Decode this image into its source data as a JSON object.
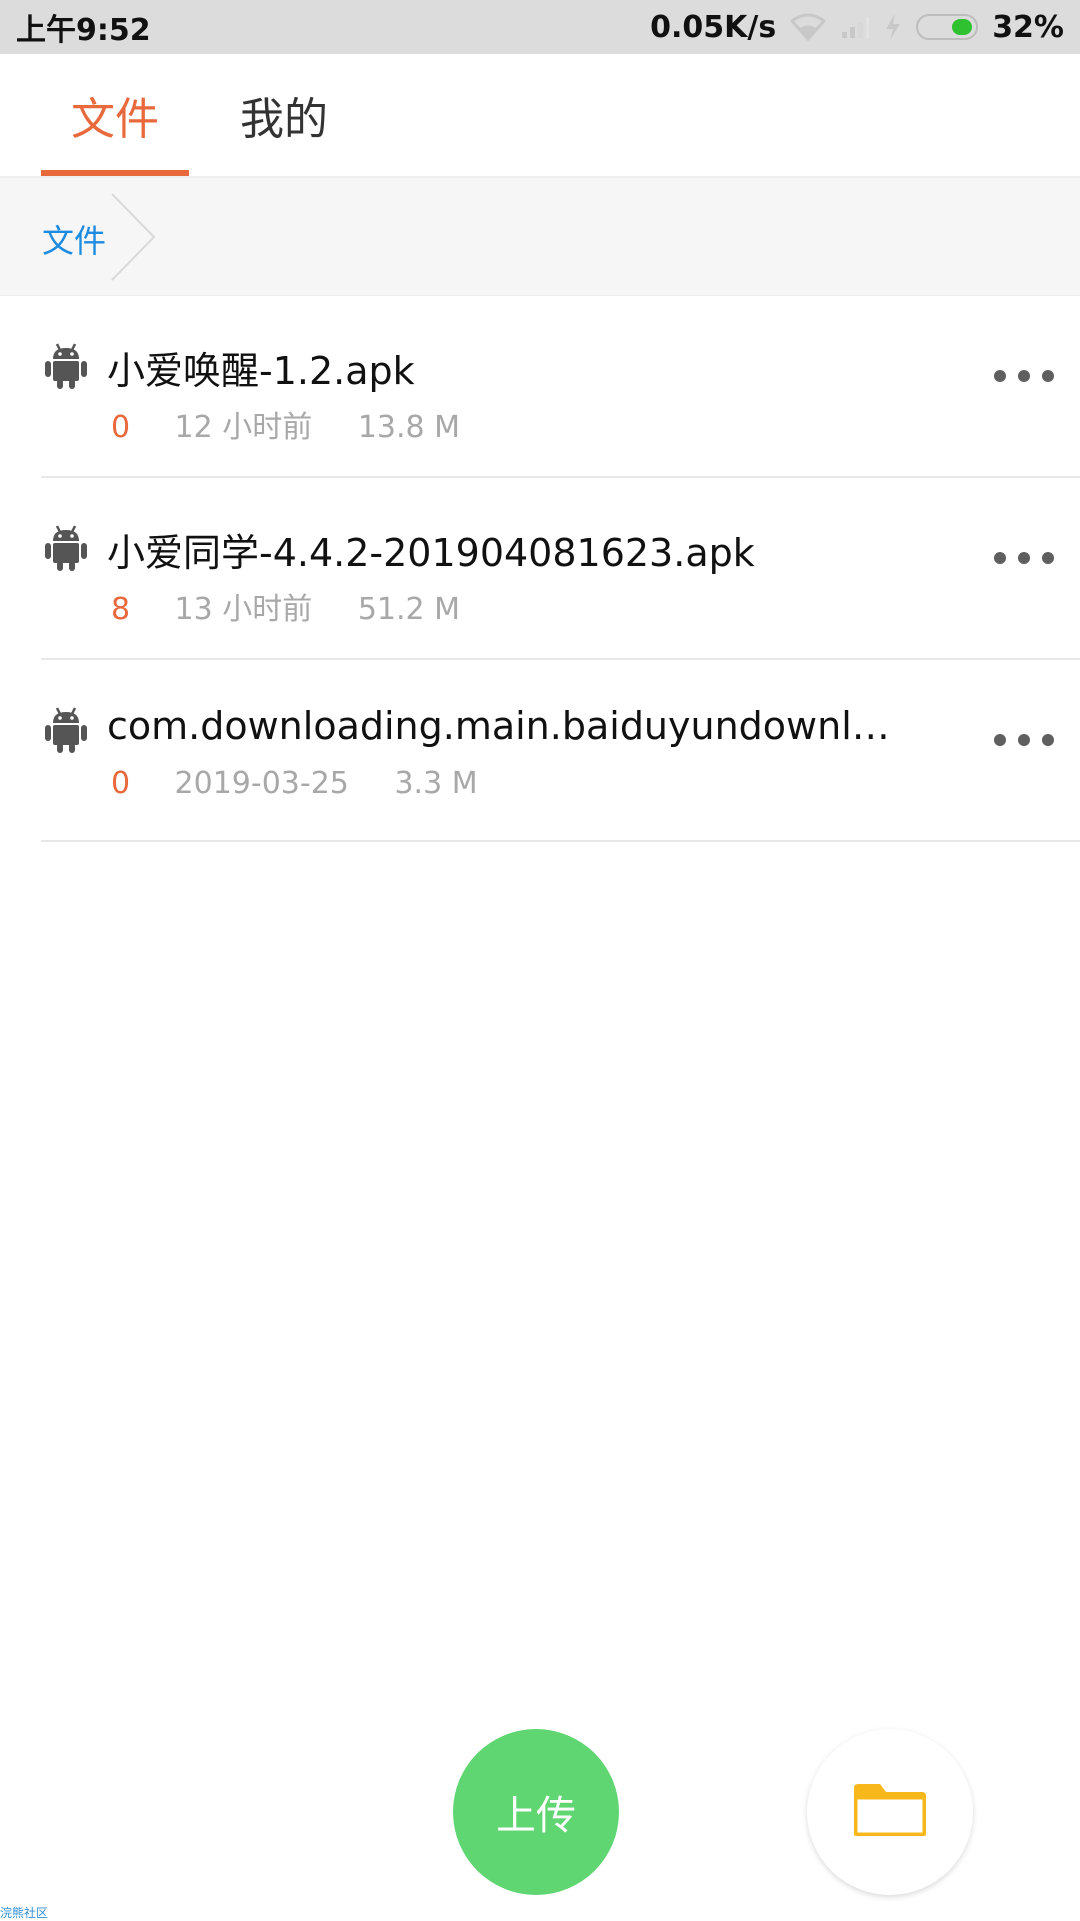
{
  "colors": {
    "accent": "#e8693b",
    "link_blue": "#1d8ce0",
    "upload_green": "#5fd672",
    "folder_yellow": "#f8b81b",
    "battery_green": "#2fc12f"
  },
  "status_bar": {
    "time": "上午9:52",
    "net_speed": "0.05K/s",
    "battery": "32%",
    "icons": [
      "wifi-icon",
      "signal-icon",
      "charging-icon",
      "battery-icon"
    ]
  },
  "tabs": [
    {
      "label": "文件",
      "active": true
    },
    {
      "label": "我的",
      "active": false
    }
  ],
  "breadcrumb": {
    "label": "文件"
  },
  "files": [
    {
      "name": "小爱唤醒-1.2.apk",
      "count": "0",
      "time": "12 小时前",
      "size": "13.8 M",
      "icon": "android-icon"
    },
    {
      "name": "小爱同学-4.4.2-201904081623.apk",
      "count": "8",
      "time": "13 小时前",
      "size": "51.2 M",
      "icon": "android-icon"
    },
    {
      "name": "com.downloading.main.baiduyundownloa…",
      "count": "0",
      "time": "2019-03-25",
      "size": "3.3 M",
      "icon": "android-icon"
    }
  ],
  "actions": {
    "upload_label": "上传",
    "folder_icon": "folder-icon"
  },
  "watermark": "浣熊社区"
}
